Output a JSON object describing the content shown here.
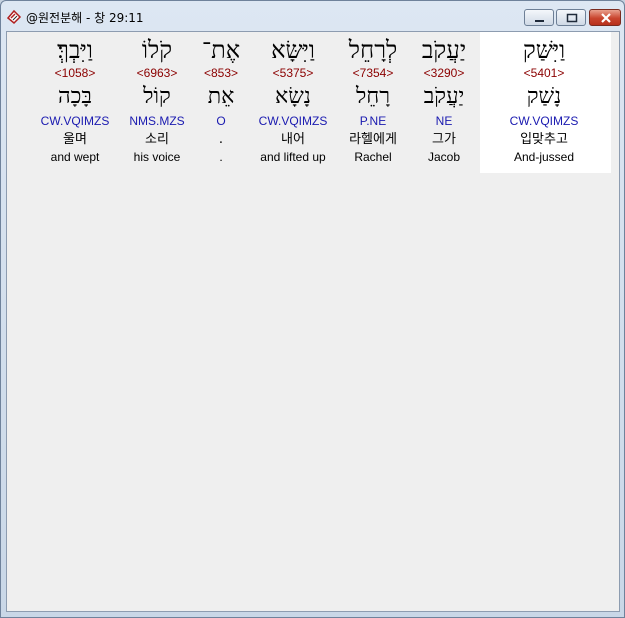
{
  "window": {
    "title": "@원전분해 - 창 29:11"
  },
  "words": [
    {
      "hebrew": "וַיִּבְךְּ׃",
      "strong": "<1058>",
      "lemma": "בָּכָה",
      "parse": "CW.VQIMZS",
      "korean": "울며",
      "english": "and wept"
    },
    {
      "hebrew": "קֹלוֹ",
      "strong": "<6963>",
      "lemma": "קוֹל",
      "parse": "NMS.MZS",
      "korean": "소리",
      "english": "his voice"
    },
    {
      "hebrew": "אֶת־",
      "strong": "<853>",
      "lemma": "אֵת",
      "parse": "O",
      "korean": ".",
      "english": "."
    },
    {
      "hebrew": "וַיִּשָּׂא",
      "strong": "<5375>",
      "lemma": "נָשָׂא",
      "parse": "CW.VQIMZS",
      "korean": "내어",
      "english": "and lifted up"
    },
    {
      "hebrew": "לְרָחֵל",
      "strong": "<7354>",
      "lemma": "רָחֵל",
      "parse": "P.NE",
      "korean": "라헬에게",
      "english": "Rachel"
    },
    {
      "hebrew": "יַעֲקֹב",
      "strong": "<3290>",
      "lemma": "יַעֲקֹב",
      "parse": "NE",
      "korean": "그가",
      "english": "Jacob"
    },
    {
      "hebrew": "וַיִּשַּׁק",
      "strong": "<5401>",
      "lemma": "נָשַׁק",
      "parse": "CW.VQIMZS",
      "korean": "입맞추고",
      "english": "And-jussed"
    }
  ],
  "colors": {
    "strong_number": "#8b0000",
    "parsing": "#1a1ab0",
    "selected_column_bg": "#ffffff",
    "client_bg": "#efefef"
  }
}
